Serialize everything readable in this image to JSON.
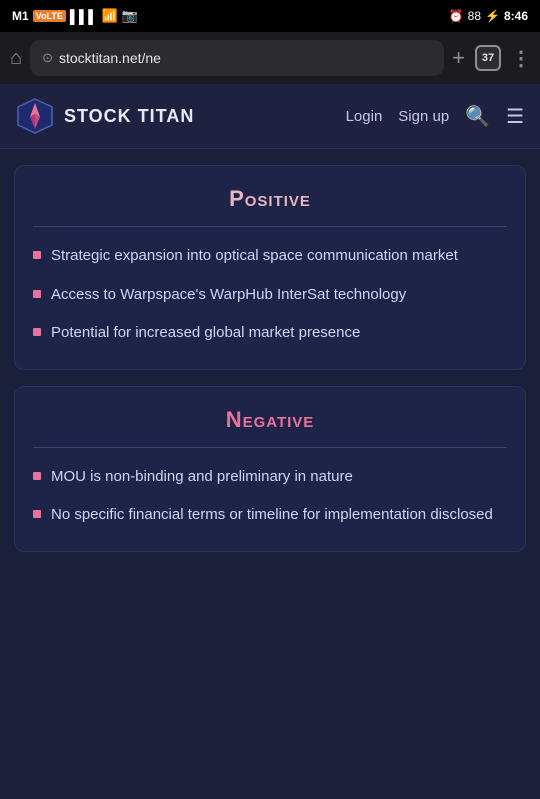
{
  "statusBar": {
    "carrier": "M1",
    "carrierBadge": "VoLTE",
    "alarm": "🕐",
    "battery": "88",
    "time": "8:46"
  },
  "browserBar": {
    "url": "stocktitan.net/ne",
    "tabCount": "37"
  },
  "siteNav": {
    "logoText": "STOCK TITAN",
    "loginLabel": "Login",
    "signupLabel": "Sign up"
  },
  "positive": {
    "title": "Positive",
    "bullets": [
      "Strategic expansion into optical space communication market",
      "Access to Warpspace's WarpHub InterSat technology",
      "Potential for increased global market presence"
    ]
  },
  "negative": {
    "title": "Negative",
    "bullets": [
      "MOU is non-binding and preliminary in nature",
      "No specific financial terms or timeline for implementation disclosed"
    ]
  }
}
